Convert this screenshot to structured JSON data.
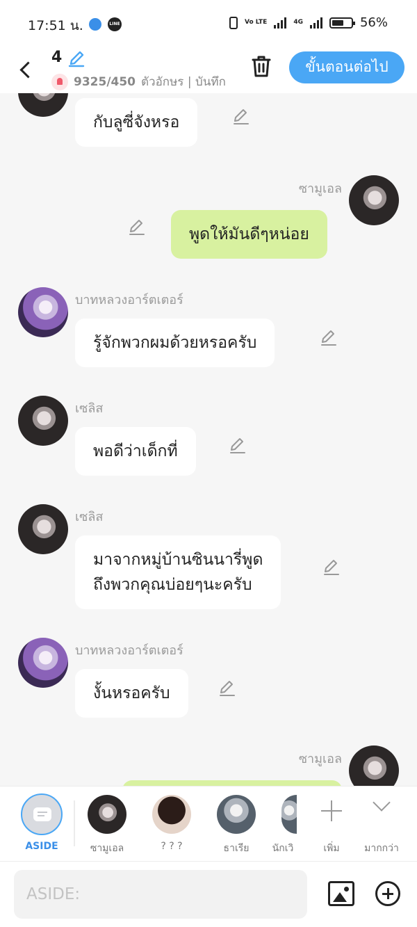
{
  "status_bar": {
    "time": "17:51 น.",
    "network_label": "4G",
    "volte_label": "Vo LTE",
    "battery": "56%",
    "line_label": "LINE"
  },
  "header": {
    "episode_number": "4",
    "counter": "9325/450",
    "counter_suffix": "ตัวอักษร | บันทึก",
    "next_button": "ขั้นตอนต่อไป"
  },
  "messages": [
    {
      "speaker": "",
      "text": "กับลูซี่จังหรอ",
      "side": "left",
      "avatar": "dark"
    },
    {
      "speaker": "ซามูเอล",
      "text": "พูดให้มันดีๆหน่อย",
      "side": "right",
      "avatar": "dark"
    },
    {
      "speaker": "บาทหลวงอาร์ตเตอร์",
      "text": "รู้จักพวกผมด้วยหรอครับ",
      "side": "left",
      "avatar": "purple"
    },
    {
      "speaker": "เซลิส",
      "text": "พอดีว่าเด็กที่",
      "side": "left",
      "avatar": "dark"
    },
    {
      "speaker": "เซลิส",
      "text_line1": "มาจากหมู่บ้านซินนารี่พูด",
      "text_line2": "ถึงพวกคุณบ่อยๆนะครับ",
      "side": "left",
      "avatar": "dark"
    },
    {
      "speaker": "บาทหลวงอาร์ตเตอร์",
      "text": "งั้นหรอครับ",
      "side": "left",
      "avatar": "purple"
    },
    {
      "speaker": "ซามูเอล",
      "text": "",
      "side": "right",
      "avatar": "dark"
    }
  ],
  "characters": [
    {
      "label": "ASIDE",
      "active": true
    },
    {
      "label": "ซามูเอล"
    },
    {
      "label": "? ? ?"
    },
    {
      "label": "ธาเรีย"
    },
    {
      "label": "นักเวิ"
    }
  ],
  "char_actions": {
    "add_label": "เพิ่ม",
    "more_label": "มากกว่า"
  },
  "input": {
    "placeholder": "ASIDE:"
  }
}
